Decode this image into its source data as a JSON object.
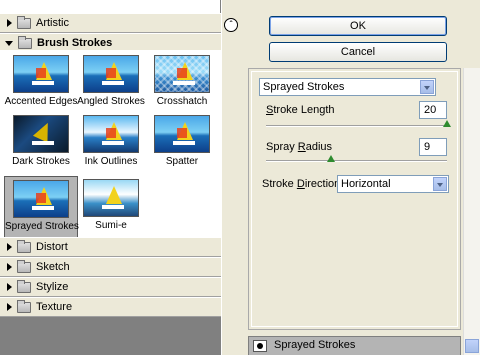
{
  "buttons": {
    "ok": "OK",
    "cancel": "Cancel"
  },
  "categories": {
    "artistic": "Artistic",
    "brush_strokes": "Brush Strokes",
    "distort": "Distort",
    "sketch": "Sketch",
    "stylize": "Stylize",
    "texture": "Texture"
  },
  "thumbnails": [
    "Accented Edges",
    "Angled Strokes",
    "Crosshatch",
    "Dark Strokes",
    "Ink Outlines",
    "Spatter",
    "Sprayed Strokes",
    "Sumi-e"
  ],
  "selected_filter": "Sprayed Strokes",
  "controls": {
    "filter_select": "Sprayed Strokes",
    "stroke_length_label_pre": "",
    "stroke_length_label_u": "S",
    "stroke_length_label_post": "troke Length",
    "stroke_length": "20",
    "stroke_length_level": 1.0,
    "spray_radius_label_pre": "Spray ",
    "spray_radius_label_u": "R",
    "spray_radius_label_post": "adius",
    "spray_radius": "9",
    "spray_radius_level": 0.36,
    "direction_label_pre": "Stroke ",
    "direction_label_u": "D",
    "direction_label_post": "irection:",
    "direction_value": "Horizontal"
  },
  "layer": {
    "name": "Sprayed Strokes"
  },
  "icons": {
    "collapse": "double-chevron-up-icon",
    "eye": "eye-icon",
    "folder": "folder-icon"
  }
}
